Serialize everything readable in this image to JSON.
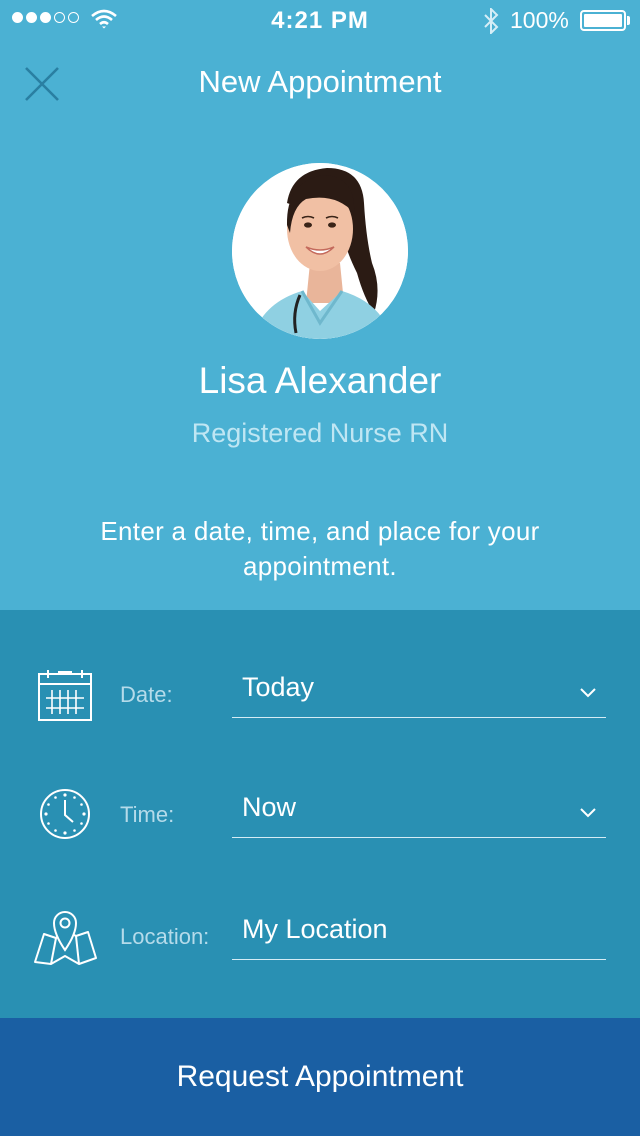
{
  "status_bar": {
    "time": "4:21 PM",
    "battery": "100%",
    "signal_bars": 3,
    "signal_total": 5
  },
  "header": {
    "title": "New Appointment",
    "close_icon": "close-icon"
  },
  "profile": {
    "name": "Lisa Alexander",
    "role": "Registered Nurse RN"
  },
  "instructions": "Enter a date, time, and place for your appointment.",
  "form": {
    "date": {
      "label": "Date:",
      "value": "Today",
      "icon": "calendar-icon"
    },
    "time": {
      "label": "Time:",
      "value": "Now",
      "icon": "clock-icon"
    },
    "location": {
      "label": "Location:",
      "value": "My Location",
      "icon": "map-pin-icon"
    }
  },
  "request_button": "Request Appointment",
  "colors": {
    "top_background": "#4bb1d3",
    "form_background": "#2990b3",
    "button_background": "#1a5fa3"
  }
}
